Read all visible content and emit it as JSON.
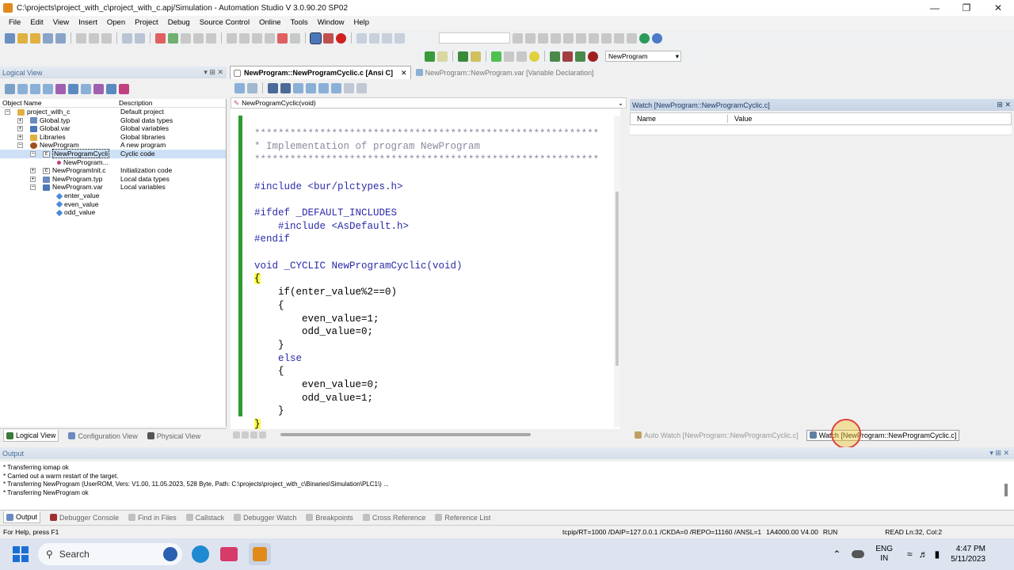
{
  "window": {
    "title": "C:\\projects\\project_with_c\\project_with_c.apj/Simulation - Automation Studio V 3.0.90.20 SP02"
  },
  "menu": [
    "File",
    "Edit",
    "View",
    "Insert",
    "Open",
    "Project",
    "Debug",
    "Source Control",
    "Online",
    "Tools",
    "Window",
    "Help"
  ],
  "toolbar": {
    "program_select": "NewProgram"
  },
  "logical_view": {
    "title": "Logical View",
    "col_name": "Object Name",
    "col_desc": "Description",
    "rows": [
      {
        "name": "project_with_c",
        "desc": "Default project"
      },
      {
        "name": "Global.typ",
        "desc": "Global data types"
      },
      {
        "name": "Global.var",
        "desc": "Global variables"
      },
      {
        "name": "Libraries",
        "desc": "Global libraries"
      },
      {
        "name": "NewProgram",
        "desc": "A new program"
      },
      {
        "name": "NewProgramCycli",
        "desc": "Cyclic code"
      },
      {
        "name": "NewProgram...",
        "desc": ""
      },
      {
        "name": "NewProgramInit.c",
        "desc": "Initialization code"
      },
      {
        "name": "NewProgram.typ",
        "desc": "Local data types"
      },
      {
        "name": "NewProgram.var",
        "desc": "Local variables"
      },
      {
        "name": "enter_value",
        "desc": ""
      },
      {
        "name": "even_value",
        "desc": ""
      },
      {
        "name": "odd_value",
        "desc": ""
      }
    ],
    "tabs": [
      "Logical View",
      "Configuration View",
      "Physical View"
    ]
  },
  "editor": {
    "tabs": [
      "NewProgram::NewProgramCyclic.c [Ansi C]",
      "NewProgram::NewProgram.var [Variable Declaration]"
    ],
    "function_select": "NewProgramCyclic(void)",
    "lines": [
      "**********************************************************",
      "* Implementation of program NewProgram",
      "**********************************************************",
      "",
      "#include <bur/plctypes.h>",
      "",
      "#ifdef _DEFAULT_INCLUDES",
      "    #include <AsDefault.h>",
      "#endif",
      "",
      "void _CYCLIC NewProgramCyclic(void)",
      "{",
      "    if(enter_value%2==0)",
      "    {",
      "        even_value=1;",
      "        odd_value=0;",
      "    }",
      "    else",
      "    {",
      "        even_value=0;",
      "        odd_value=1;",
      "    }",
      "}"
    ]
  },
  "watch": {
    "title": "Watch [NewProgram::NewProgramCyclic.c]",
    "col_name": "Name",
    "col_value": "Value",
    "tabs": [
      "Auto Watch [NewProgram::NewProgramCyclic.c]",
      "Watch [NewProgram::NewProgramCyclic.c]"
    ]
  },
  "output": {
    "title": "Output",
    "lines": [
      "* Transferring iomap ok",
      "* Carried out a warm restart of the target.",
      "* Transferring NewProgram (UserROM, Vers: V1.00, 11.05.2023, 528 Byte, Path: C:\\projects\\project_with_c\\Binaries\\Simulation\\PLC1\\) ...",
      "* Transferring NewProgram ok"
    ],
    "tabs": [
      "Output",
      "Debugger Console",
      "Find in Files",
      "Callstack",
      "Debugger Watch",
      "Breakpoints",
      "Cross Reference",
      "Reference List"
    ]
  },
  "status": {
    "help": "For Help, press F1",
    "connection": "tcpip/RT=1000 /DAIP=127.0.0.1 /CKDA=0 /REPO=11160 /ANSL=1",
    "version": "1A4000.00  V4.00",
    "mode": "RUN",
    "cursor": "READ  Ln:32, Col:2"
  },
  "taskbar": {
    "search": "Search",
    "lang1": "ENG",
    "lang2": "IN",
    "time": "4:47 PM",
    "date": "5/11/2023"
  }
}
